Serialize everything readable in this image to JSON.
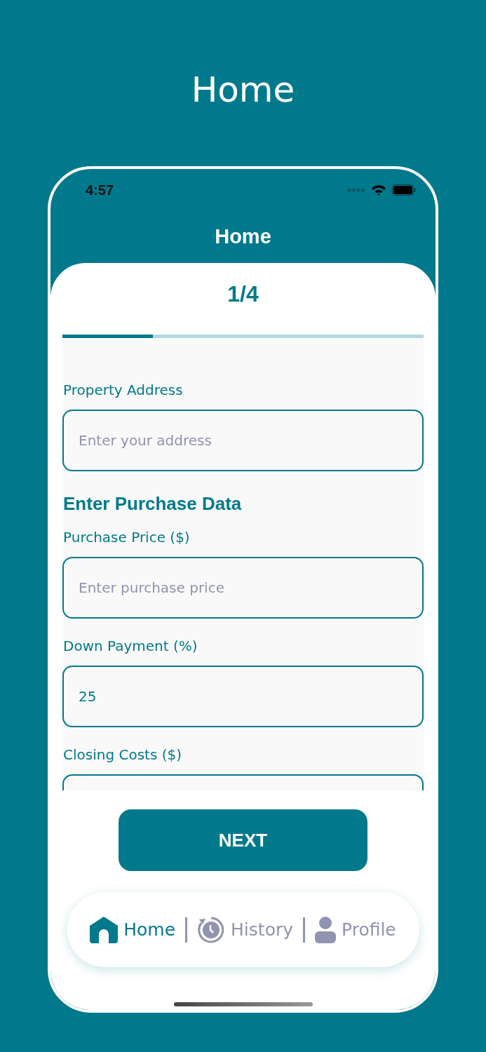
{
  "page_title": "Home",
  "status_bar": {
    "time": "4:57"
  },
  "header": {
    "title": "Home"
  },
  "step": {
    "label": "1/4",
    "level": 0.25
  },
  "form": [
    {
      "kind": "field",
      "label": "Property Address",
      "placeholder": "Enter your address"
    },
    {
      "kind": "heading",
      "text": "Enter Purchase Data"
    },
    {
      "kind": "field",
      "label": "Purchase Price ($)",
      "placeholder": "Enter purchase price"
    },
    {
      "kind": "field",
      "label": "Down Payment (%)",
      "value": "25"
    },
    {
      "kind": "field",
      "label": "Closing Costs ($)"
    }
  ],
  "button": "NEXT",
  "nav": [
    {
      "kind": "home",
      "label": "Home",
      "selected": true
    },
    {
      "kind": "history",
      "label": "History",
      "selected": false
    },
    {
      "kind": "profile",
      "label": "Profile",
      "selected": false
    }
  ]
}
